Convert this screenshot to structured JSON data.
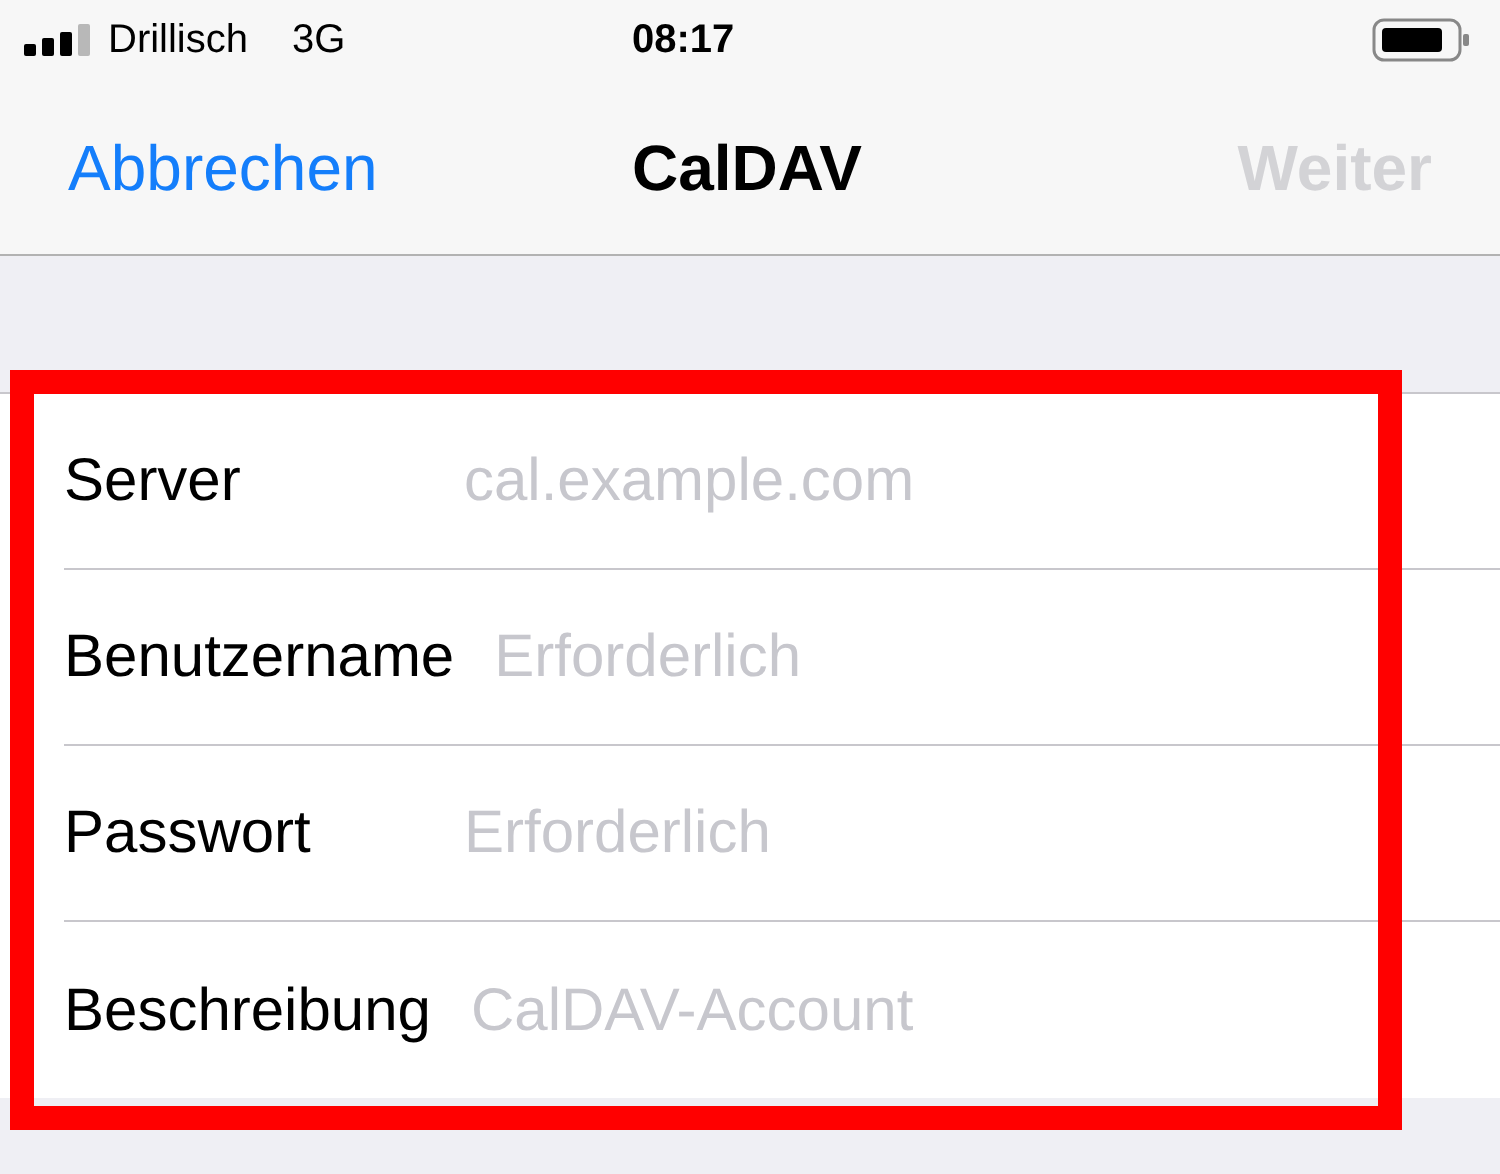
{
  "status_bar": {
    "carrier": "Drillisch",
    "network": "3G",
    "time": "08:17"
  },
  "nav": {
    "cancel": "Abbrechen",
    "title": "CalDAV",
    "next": {
      "label": "Weiter",
      "disabled": true
    }
  },
  "fields": [
    {
      "label": "Server",
      "placeholder": "cal.example.com"
    },
    {
      "label": "Benutzername",
      "placeholder": "Erforderlich"
    },
    {
      "label": "Passwort",
      "placeholder": "Erforderlich"
    },
    {
      "label": "Beschreibung",
      "placeholder": "CalDAV-Account"
    }
  ]
}
